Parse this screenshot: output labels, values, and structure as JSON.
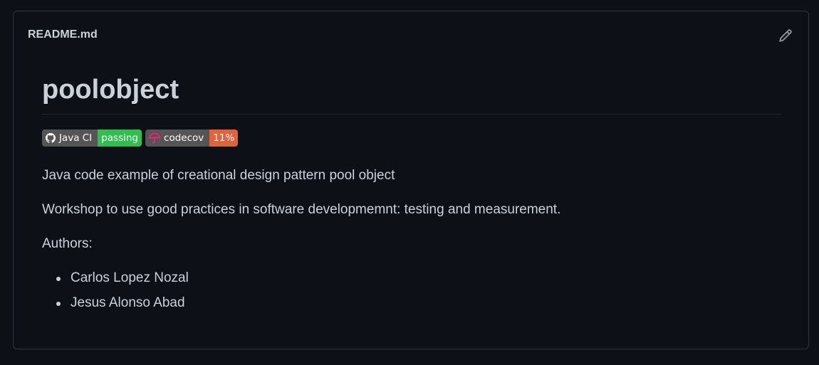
{
  "readme": {
    "filename": "README.md",
    "edit_icon": "pencil-icon",
    "title": "poolobject",
    "badges": [
      {
        "label": "Java CI",
        "value": "passing",
        "icon": "github-icon",
        "color": "#2fbe4f"
      },
      {
        "label": "codecov",
        "value": "11%",
        "icon": "codecov-umbrella-icon",
        "color": "#e0633b"
      }
    ],
    "description": "Java code example of creational design pattern pool object",
    "workshop": "Workshop to use good practices in software developmemnt: testing and measurement.",
    "authors_label": "Authors:",
    "authors": [
      "Carlos Lopez Nozal",
      "Jesus Alonso Abad"
    ]
  }
}
